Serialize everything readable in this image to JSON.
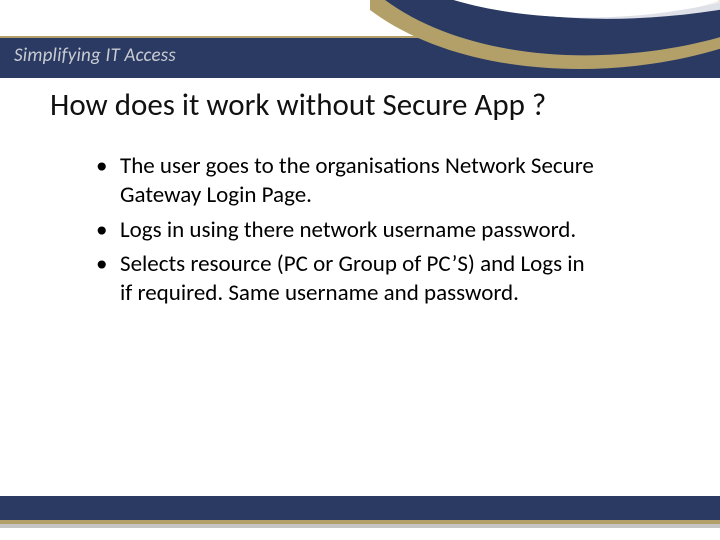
{
  "banner": {
    "tagline": "Simplifying IT Access"
  },
  "title": "How does it work without Secure App ?",
  "bullets": [
    "The user goes to the organisations Network Secure Gateway Login Page.",
    "Logs in using there network username password.",
    "Selects resource (PC or Group of PC’S) and Logs in if required. Same username and password."
  ],
  "colors": {
    "navy": "#2a3a63",
    "gold": "#b3a069"
  }
}
